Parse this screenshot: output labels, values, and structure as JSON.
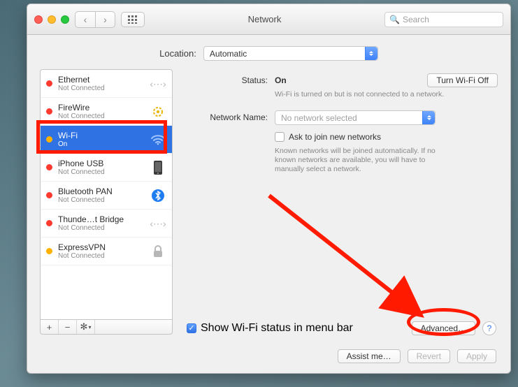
{
  "window": {
    "title": "Network"
  },
  "toolbar": {
    "search_placeholder": "Search"
  },
  "location": {
    "label": "Location:",
    "value": "Automatic"
  },
  "sidebar": {
    "items": [
      {
        "name": "Ethernet",
        "sub": "Not Connected",
        "status": "red",
        "icon": "ethernet"
      },
      {
        "name": "FireWire",
        "sub": "Not Connected",
        "status": "red",
        "icon": "firewire"
      },
      {
        "name": "Wi-Fi",
        "sub": "On",
        "status": "amber",
        "icon": "wifi",
        "selected": true
      },
      {
        "name": "iPhone USB",
        "sub": "Not Connected",
        "status": "red",
        "icon": "iphone"
      },
      {
        "name": "Bluetooth PAN",
        "sub": "Not Connected",
        "status": "red",
        "icon": "bluetooth"
      },
      {
        "name": "Thunde…t Bridge",
        "sub": "Not Connected",
        "status": "red",
        "icon": "ethernet"
      },
      {
        "name": "ExpressVPN",
        "sub": "Not Connected",
        "status": "amber",
        "icon": "vpn"
      }
    ]
  },
  "detail": {
    "status_label": "Status:",
    "status_value": "On",
    "wifi_off_btn": "Turn Wi-Fi Off",
    "status_desc": "Wi-Fi is turned on but is not connected to a network.",
    "netname_label": "Network Name:",
    "netname_value": "No network selected",
    "ask_join_label": "Ask to join new networks",
    "ask_join_desc": "Known networks will be joined automatically. If no known networks are available, you will have to manually select a network.",
    "show_status_label": "Show Wi-Fi status in menu bar",
    "advanced_btn": "Advanced…"
  },
  "footer": {
    "assist": "Assist me…",
    "revert": "Revert",
    "apply": "Apply"
  }
}
